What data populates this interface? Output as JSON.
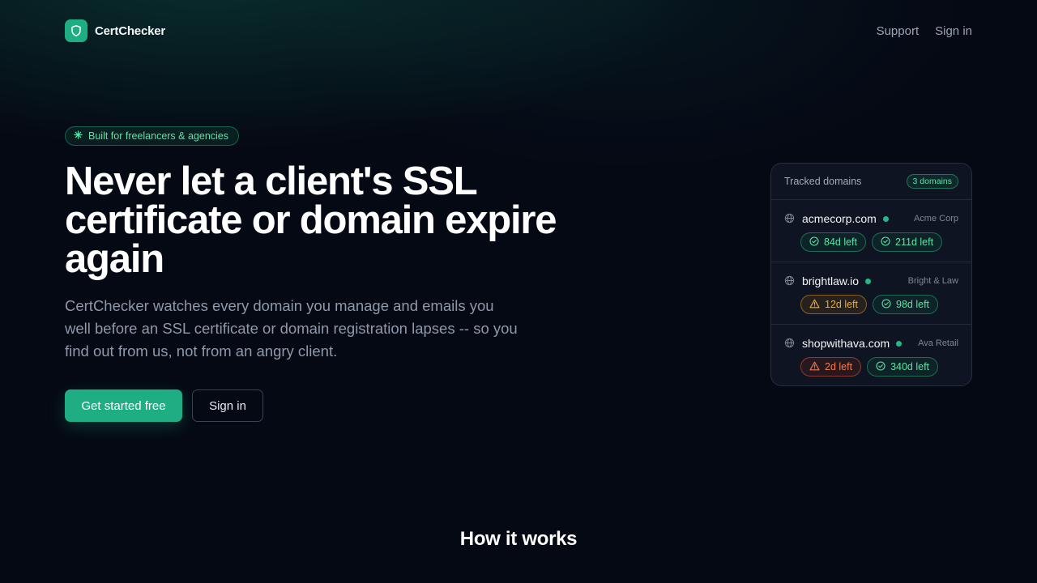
{
  "nav": {
    "brand": "CertChecker",
    "links": [
      "Support",
      "Sign in"
    ]
  },
  "hero": {
    "badge": "Built for freelancers & agencies",
    "headline": "Never let a client's SSL certificate or domain expire again",
    "subtext": "CertChecker watches every domain you manage and emails you well before an SSL certificate or domain registration lapses -- so you find out from us, not from an angry client.",
    "primary_cta": "Get started free",
    "secondary_cta": "Sign in"
  },
  "card": {
    "title": "Tracked domains",
    "count": "3 domains",
    "rows": [
      {
        "domain": "acmecorp.com",
        "client": "Acme Corp",
        "ssl": "84d left",
        "ssl_status": "ok",
        "reg": "211d left",
        "reg_status": "ok"
      },
      {
        "domain": "brightlaw.io",
        "client": "Bright & Law",
        "ssl": "12d left",
        "ssl_status": "warn",
        "reg": "98d left",
        "reg_status": "ok"
      },
      {
        "domain": "shopwithava.com",
        "client": "Ava Retail",
        "ssl": "2d left",
        "ssl_status": "crit",
        "reg": "340d left",
        "reg_status": "ok"
      }
    ]
  },
  "section": {
    "title": "How it works"
  },
  "colors": {
    "accent": "#1fae84",
    "ok": "#5fe0a8",
    "warn": "#f0a83a",
    "crit": "#f07a52",
    "background": "#050914"
  },
  "icons": {
    "logo": "shield-icon",
    "badge": "sparkle-icon",
    "domain": "globe-icon",
    "ok": "check-circle-icon",
    "warn": "warning-triangle-icon"
  }
}
